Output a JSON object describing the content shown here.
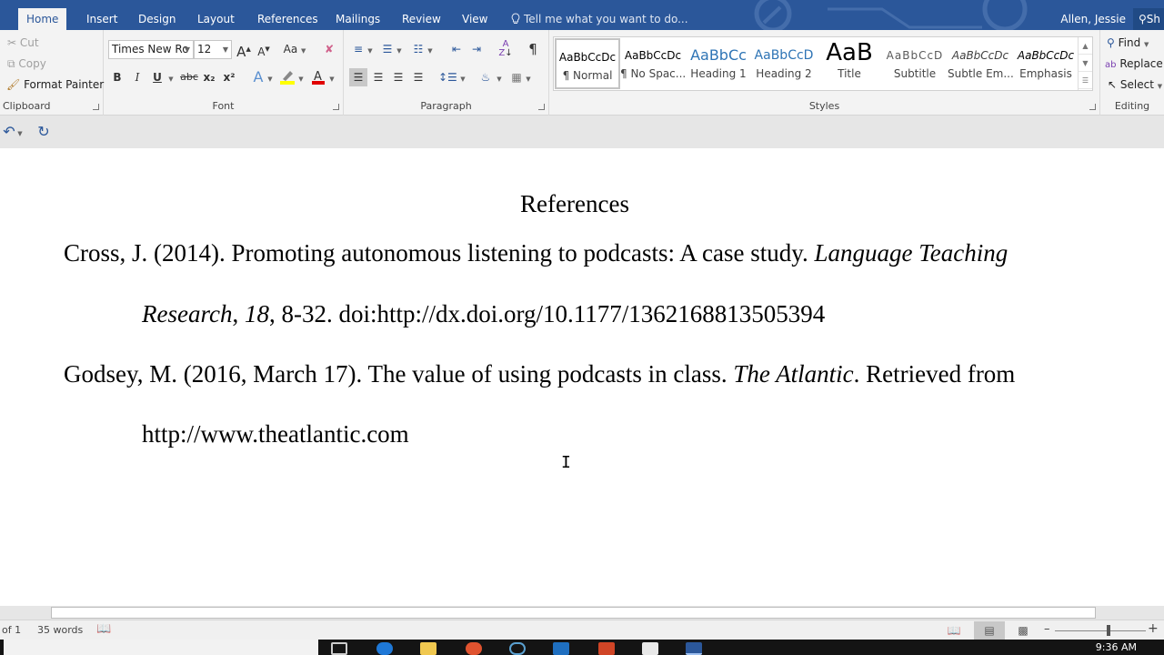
{
  "ribbon_tabs": [
    {
      "label": "Home",
      "active": true
    },
    {
      "label": "Insert"
    },
    {
      "label": "Design"
    },
    {
      "label": "Layout"
    },
    {
      "label": "References"
    },
    {
      "label": "Mailings"
    },
    {
      "label": "Review"
    },
    {
      "label": "View"
    }
  ],
  "tell_me": "Tell me what you want to do...",
  "user_name": "Allen, Jessie",
  "share_label": "Sh",
  "clipboard": {
    "cut": "Cut",
    "copy": "Copy",
    "format_painter": "Format Painter",
    "group_label": "Clipboard"
  },
  "font": {
    "family": "Times New Ro",
    "size": "12",
    "change_case": "Aa",
    "bold": "B",
    "italic": "I",
    "underline": "U",
    "strikethrough": "abc",
    "subscript": "x₂",
    "superscript": "x²",
    "group_label": "Font",
    "highlight_color": "#ffff00",
    "font_color": "#e00000"
  },
  "paragraph": {
    "group_label": "Paragraph",
    "pilcrow": "¶"
  },
  "styles": {
    "group_label": "Styles",
    "items": [
      {
        "preview": "AaBbCcDc",
        "name": "¶ Normal",
        "selected": true
      },
      {
        "preview": "AaBbCcDc",
        "name": "¶ No Spac..."
      },
      {
        "preview": "AaBbCc",
        "name": "Heading 1"
      },
      {
        "preview": "AaBbCcD",
        "name": "Heading 2"
      },
      {
        "preview": "AaB",
        "name": "Title"
      },
      {
        "preview": "AaBbCcD",
        "name": "Subtitle"
      },
      {
        "preview": "AaBbCcDc",
        "name": "Subtle Em..."
      },
      {
        "preview": "AaBbCcDc",
        "name": "Emphasis"
      }
    ]
  },
  "editing": {
    "find": "Find",
    "replace": "Replace",
    "select": "Select",
    "group_label": "Editing"
  },
  "document": {
    "heading": "References",
    "references": [
      {
        "line1": [
          {
            "text": "Cross, J. (2014). Promoting autonomous listening to podcasts: A case study. ",
            "italic": false
          },
          {
            "text": "Language Teaching",
            "italic": true
          }
        ],
        "line2": [
          {
            "text": "Research",
            "italic": true
          },
          {
            "text": ", ",
            "italic": false
          },
          {
            "text": "18",
            "italic": true
          },
          {
            "text": ", 8-32. doi:http://dx.doi.org/10.1177/1362168813505394",
            "italic": false
          }
        ]
      },
      {
        "line1": [
          {
            "text": "Godsey, M. (2016, March 17). The value of using podcasts in class. ",
            "italic": false
          },
          {
            "text": "The Atlantic",
            "italic": true
          },
          {
            "text": ". Retrieved from",
            "italic": false
          }
        ],
        "line2": [
          {
            "text": "http://www.theatlantic.com",
            "italic": false
          }
        ]
      }
    ]
  },
  "status_bar": {
    "page": "of 1",
    "word_count": "35 words",
    "zoom_percent": 100
  },
  "taskbar": {
    "clock": "9:36 AM"
  },
  "colors": {
    "accent": "#2b579a"
  }
}
